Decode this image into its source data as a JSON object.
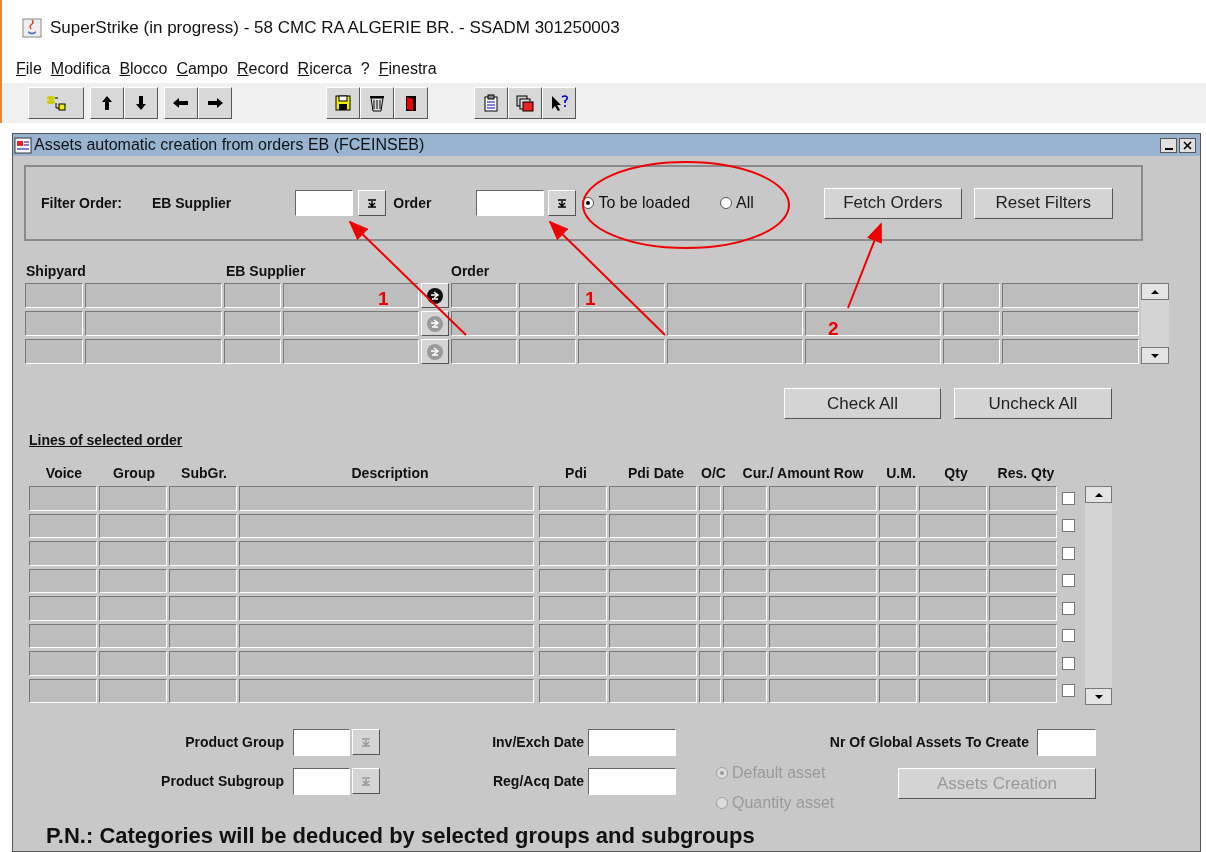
{
  "window": {
    "title": "SuperStrike (in progress) - 58 CMC RA ALGERIE BR. - SSADM 301250003"
  },
  "menu": [
    {
      "label": "File",
      "underlined": true
    },
    {
      "label": "Modifica",
      "underlined": true
    },
    {
      "label": "Blocco",
      "underlined": true
    },
    {
      "label": "Campo",
      "underlined": true
    },
    {
      "label": "Record",
      "underlined": true
    },
    {
      "label": "Ricerca",
      "underlined": true
    },
    {
      "label": "?",
      "underlined": false
    },
    {
      "label": "Finestra",
      "underlined": true
    }
  ],
  "form": {
    "title": "Assets automatic creation from orders EB (FCEINSEB)"
  },
  "filter": {
    "label": "Filter Order:",
    "supplier_label": "EB Supplier",
    "order_label": "Order",
    "radios": [
      {
        "label": "To be loaded",
        "selected": true
      },
      {
        "label": "All",
        "selected": false
      }
    ],
    "buttons": [
      "Fetch Orders",
      "Reset Filters"
    ]
  },
  "orders": {
    "headers": [
      "Shipyard",
      "EB Supplier",
      "Order"
    ],
    "rows": [
      {
        "icon_enabled": true
      },
      {
        "icon_enabled": false
      },
      {
        "icon_enabled": false
      }
    ]
  },
  "check_buttons": [
    "Check All",
    "Uncheck All"
  ],
  "lines": {
    "title": "Lines of selected order",
    "columns": [
      "Voice",
      "Group",
      "SubGr.",
      "Description",
      "Pdi",
      "Pdi Date",
      "O/C",
      "Cur./ Amount Row",
      "U.M.",
      "Qty",
      "Res. Qty"
    ],
    "rows": [
      {
        "checked": false
      },
      {
        "checked": false
      },
      {
        "checked": false
      },
      {
        "checked": false
      },
      {
        "checked": false
      },
      {
        "checked": false
      },
      {
        "checked": false
      },
      {
        "checked": false
      }
    ]
  },
  "bottom": {
    "product_group_label": "Product Group",
    "product_subgroup_label": "Product Subgroup",
    "inv_date_label": "Inv/Exch Date",
    "reg_date_label": "Reg/Acq Date",
    "global_label": "Nr Of Global Assets To Create",
    "asset_types": [
      {
        "label": "Default asset",
        "selected": true,
        "disabled": true
      },
      {
        "label": "Quantity asset",
        "selected": false,
        "disabled": true
      }
    ],
    "create_button": {
      "label": "Assets Creation",
      "disabled": true
    }
  },
  "note": "P.N.: Categories will be deduced by selected groups and subgroups",
  "annotations": [
    {
      "label": "1"
    },
    {
      "label": "1"
    },
    {
      "label": "2"
    }
  ]
}
